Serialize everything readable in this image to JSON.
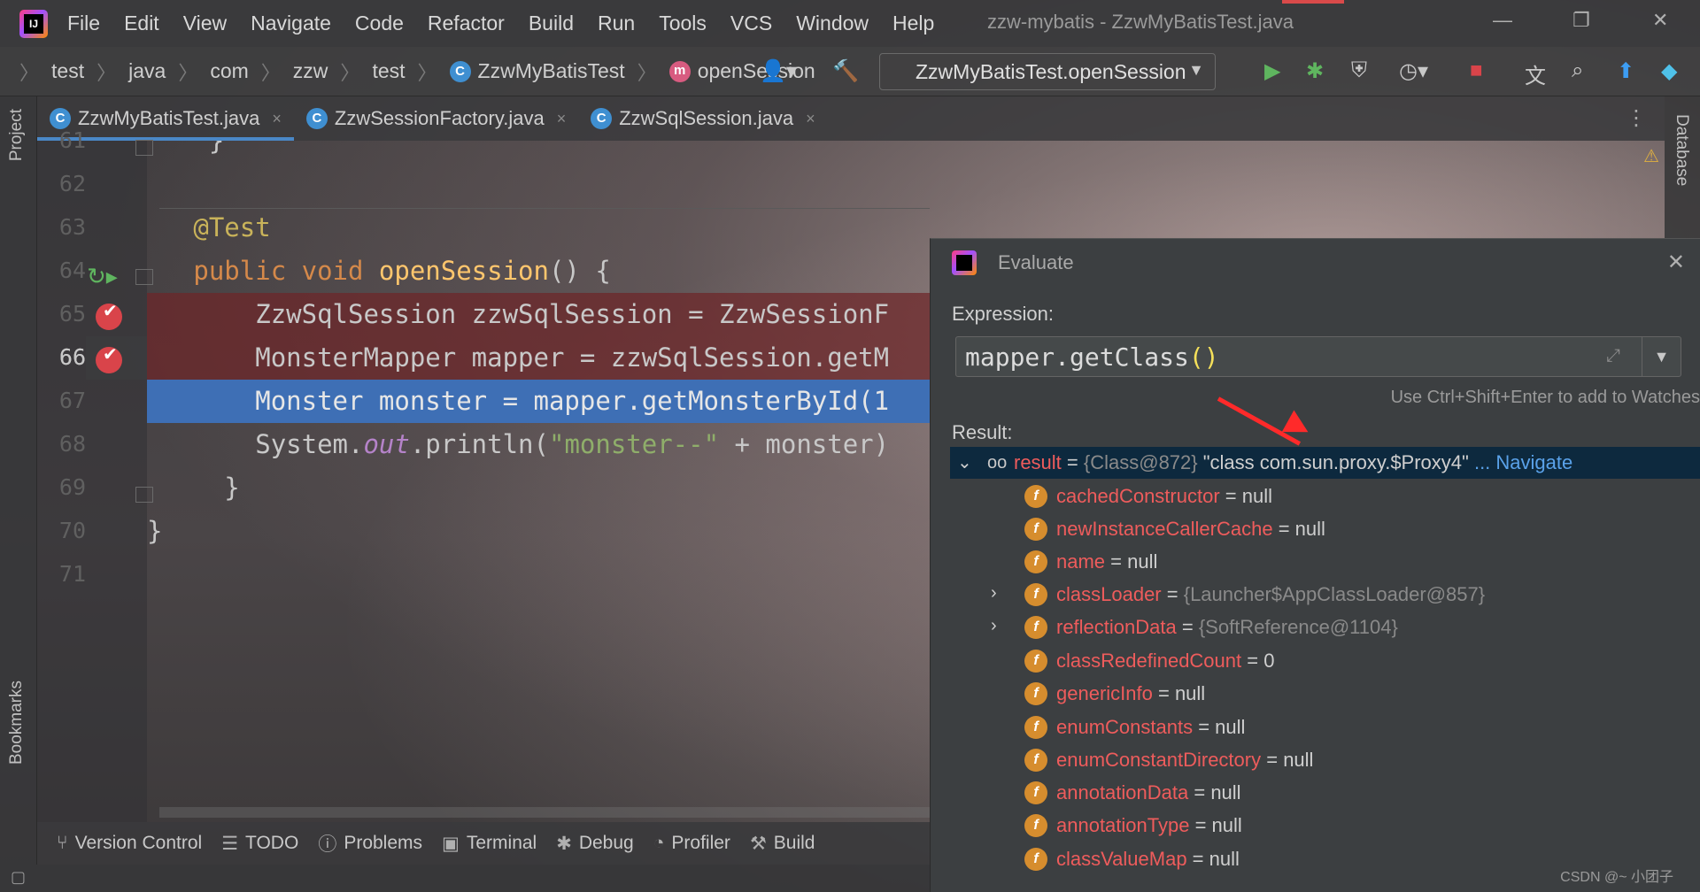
{
  "menu": [
    "File",
    "Edit",
    "View",
    "Navigate",
    "Code",
    "Refactor",
    "Build",
    "Run",
    "Tools",
    "VCS",
    "Window",
    "Help"
  ],
  "window_title": "zzw-mybatis - ZzwMyBatisTest.java",
  "breadcrumbs": [
    "test",
    "java",
    "com",
    "zzw",
    "test",
    "ZzwMyBatisTest",
    "openSession"
  ],
  "run_config": "ZzwMyBatisTest.openSession",
  "tabs": [
    {
      "label": "ZzwMyBatisTest.java",
      "active": true
    },
    {
      "label": "ZzwSessionFactory.java",
      "active": false
    },
    {
      "label": "ZzwSqlSession.java",
      "active": false
    }
  ],
  "side_labels": {
    "project": "Project",
    "bookmarks": "Bookmarks",
    "database": "Database"
  },
  "editor": {
    "line_numbers": [
      "61",
      "62",
      "63",
      "64",
      "65",
      "66",
      "67",
      "68",
      "69",
      "70",
      "71"
    ],
    "current_line": "66",
    "lines": {
      "l61": "    }",
      "l63_ann": "@Test",
      "l64_kw": "public void ",
      "l64_fn": "openSession",
      "l64_rest": "() {",
      "l65": "    ZzwSqlSession zzwSqlSession = ZzwSessionF",
      "l66": "    MonsterMapper mapper = zzwSqlSession.getM",
      "l67": "    Monster monster = mapper.getMonsterById(1",
      "l68_a": "    System.",
      "l68_b": "out",
      "l68_c": ".println(",
      "l68_d": "\"monster--\"",
      "l68_e": " + monster)",
      "l69": "  }",
      "l70": "}"
    }
  },
  "bottom_tools": [
    "Version Control",
    "TODO",
    "Problems",
    "Terminal",
    "Debug",
    "Profiler",
    "Build"
  ],
  "evaluate": {
    "title": "Evaluate",
    "expression_label": "Expression:",
    "expression_text": "mapper.getClass",
    "expression_parens": "()",
    "hint": "Use Ctrl+Shift+Enter to add to Watches",
    "result_label": "Result:",
    "result_row": {
      "name": "result",
      "eq": " = ",
      "ref": "{Class@872}",
      "value": " \"class com.sun.proxy.$Proxy4\"",
      "link": " ... Navigate"
    },
    "fields": [
      {
        "name": "cachedConstructor",
        "value": "null",
        "expandable": false
      },
      {
        "name": "newInstanceCallerCache",
        "value": "null",
        "expandable": false
      },
      {
        "name": "name",
        "value": "null",
        "expandable": false
      },
      {
        "name": "classLoader",
        "value": "{Launcher$AppClassLoader@857}",
        "expandable": true
      },
      {
        "name": "reflectionData",
        "value": "{SoftReference@1104}",
        "expandable": true
      },
      {
        "name": "classRedefinedCount",
        "value": "0",
        "expandable": false
      },
      {
        "name": "genericInfo",
        "value": "null",
        "expandable": false
      },
      {
        "name": "enumConstants",
        "value": "null",
        "expandable": false
      },
      {
        "name": "enumConstantDirectory",
        "value": "null",
        "expandable": false
      },
      {
        "name": "annotationData",
        "value": "null",
        "expandable": false
      },
      {
        "name": "annotationType",
        "value": "null",
        "expandable": false
      },
      {
        "name": "classValueMap",
        "value": "null",
        "expandable": false
      }
    ]
  },
  "watermark": "CSDN @~ 小团子",
  "colors": {
    "accent": "#4a88c7",
    "selection": "#2f65ca",
    "breakpoint": "#d9444a",
    "exec_line": "#3e6fb5",
    "field_name": "#ee5c5c",
    "annotation_arrow": "#ff2a2a"
  }
}
